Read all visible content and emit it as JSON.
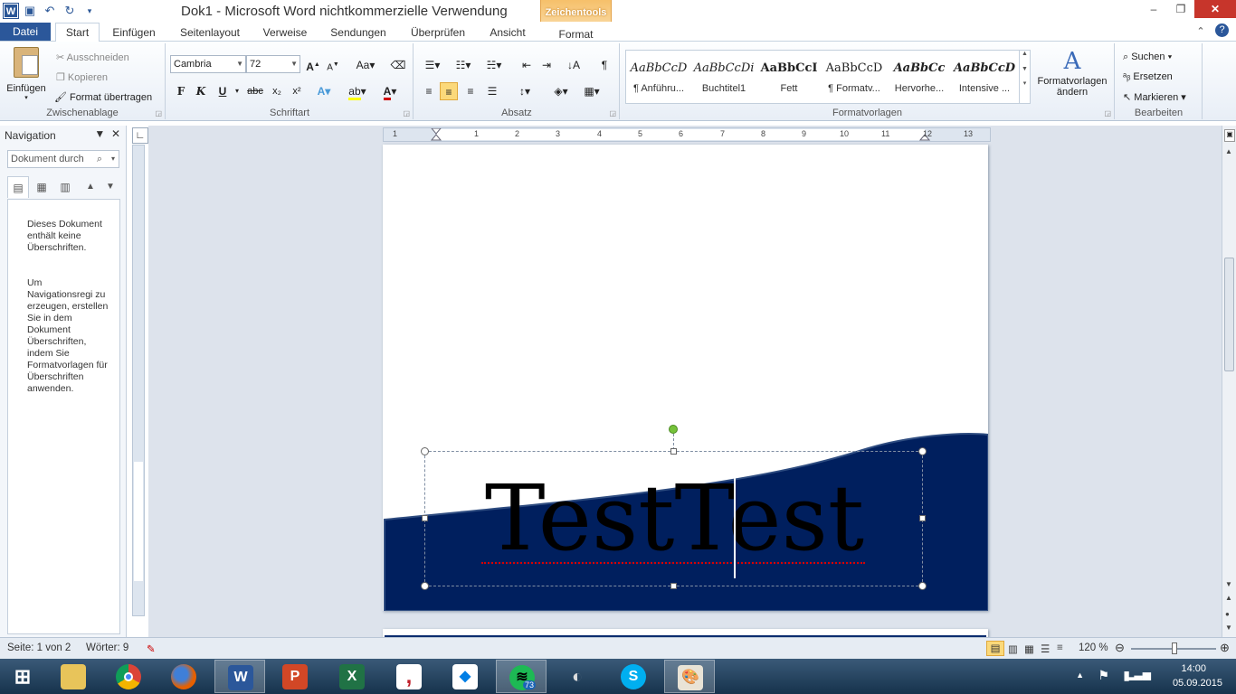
{
  "window": {
    "title": "Dok1  -  Microsoft Word nichtkommerzielle Verwendung",
    "context_group": "Zeichentools",
    "controls": [
      "–",
      "❐",
      "✕"
    ]
  },
  "tabs": [
    {
      "label": "Datei"
    },
    {
      "label": "Start"
    },
    {
      "label": "Einfügen"
    },
    {
      "label": "Seitenlayout"
    },
    {
      "label": "Verweise"
    },
    {
      "label": "Sendungen"
    },
    {
      "label": "Überprüfen"
    },
    {
      "label": "Ansicht"
    },
    {
      "label": "Format"
    }
  ],
  "clipboard": {
    "label": "Zwischenablage",
    "paste": "Einfügen",
    "cut": "Ausschneiden",
    "copy": "Kopieren",
    "format_painter": "Format übertragen"
  },
  "font": {
    "label": "Schriftart",
    "name": "Cambria",
    "size": "72",
    "bold": "F",
    "italic": "K",
    "underline": "U",
    "strike": "abc"
  },
  "paragraph": {
    "label": "Absatz",
    "pilcrow": "¶"
  },
  "styles": {
    "label": "Formatvorlagen",
    "items": [
      {
        "sample": "AaBbCcD",
        "name": "¶ Anführu..."
      },
      {
        "sample": "AaBbCcDi",
        "name": "Buchtitel1"
      },
      {
        "sample": "AaBbCcI",
        "name": "Fett"
      },
      {
        "sample": "AaBbCcD",
        "name": "¶ Formatv..."
      },
      {
        "sample": "AaBbCc",
        "name": "Hervorhe..."
      },
      {
        "sample": "AaBbCcD",
        "name": "Intensive ..."
      }
    ],
    "change": "Formatvorlagen ändern"
  },
  "editing": {
    "label": "Bearbeiten",
    "find": "Suchen",
    "replace": "Ersetzen",
    "select": "Markieren"
  },
  "navigation": {
    "title": "Navigation",
    "search_placeholder": "Dokument durch",
    "message1": "Dieses Dokument enthält keine Überschriften.",
    "message2": "Um Navigationsregi zu erzeugen, erstellen Sie in dem Dokument Überschriften, indem Sie Formatvorlagen für Überschriften anwenden."
  },
  "ruler": {
    "numbers": [
      "1",
      "1",
      "2",
      "3",
      "4",
      "5",
      "6",
      "7",
      "8",
      "9",
      "10",
      "11",
      "12",
      "13"
    ]
  },
  "document": {
    "textbox_text": "TestTest",
    "shape_fill": "#001f5e"
  },
  "status": {
    "page": "Seite: 1 von 2",
    "words": "Wörter: 9",
    "zoom": "120 %"
  },
  "taskbar": {
    "time": "14:00",
    "date": "05.09.2015",
    "spotify_badge": "73"
  }
}
